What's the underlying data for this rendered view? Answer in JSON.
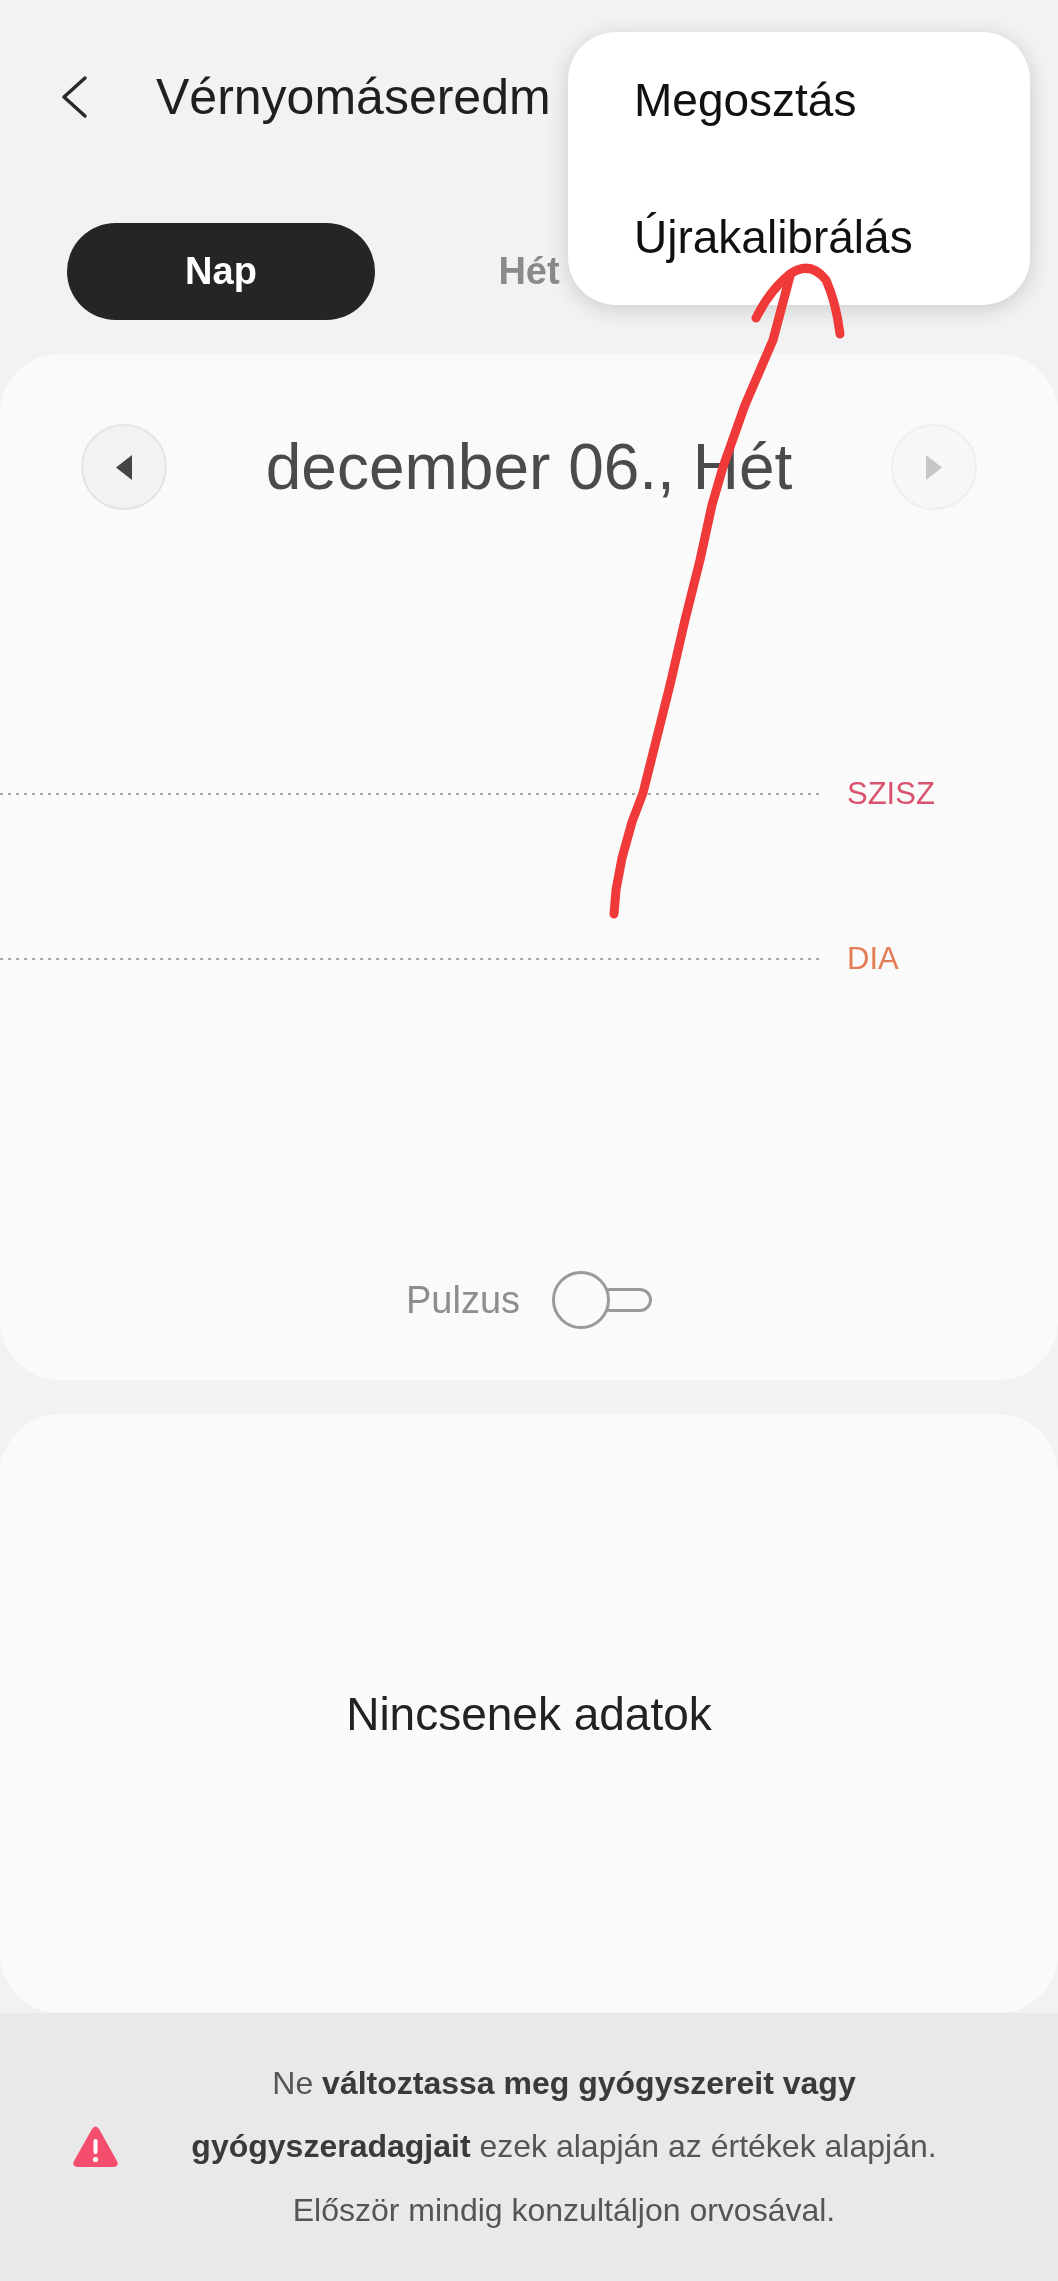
{
  "header": {
    "title": "Vérnyomáseredm"
  },
  "menu": {
    "items": [
      {
        "label": "Megosztás"
      },
      {
        "label": "Újrakalibrálás"
      }
    ]
  },
  "tabs": [
    {
      "label": "Nap",
      "selected": true
    },
    {
      "label": "Hét",
      "selected": false
    }
  ],
  "date_nav": {
    "date": "december 06., Hét",
    "previous": {
      "disabled": false
    },
    "next": {
      "disabled": true
    }
  },
  "chart": {
    "reference_lines": [
      {
        "label": "SZISZ",
        "color": "#d9536f"
      },
      {
        "label": "DIA",
        "color": "#e27d55"
      }
    ],
    "pulse_toggle": {
      "label": "Pulzus",
      "on": false
    }
  },
  "data_card": {
    "message": "Nincsenek adatok"
  },
  "warning": {
    "text": "Ne **változtassa meg gyógyszereit vagy gyógyszeradagjait** ezek alapján az értékek alapján. Először mindig konzultáljon orvosával."
  }
}
